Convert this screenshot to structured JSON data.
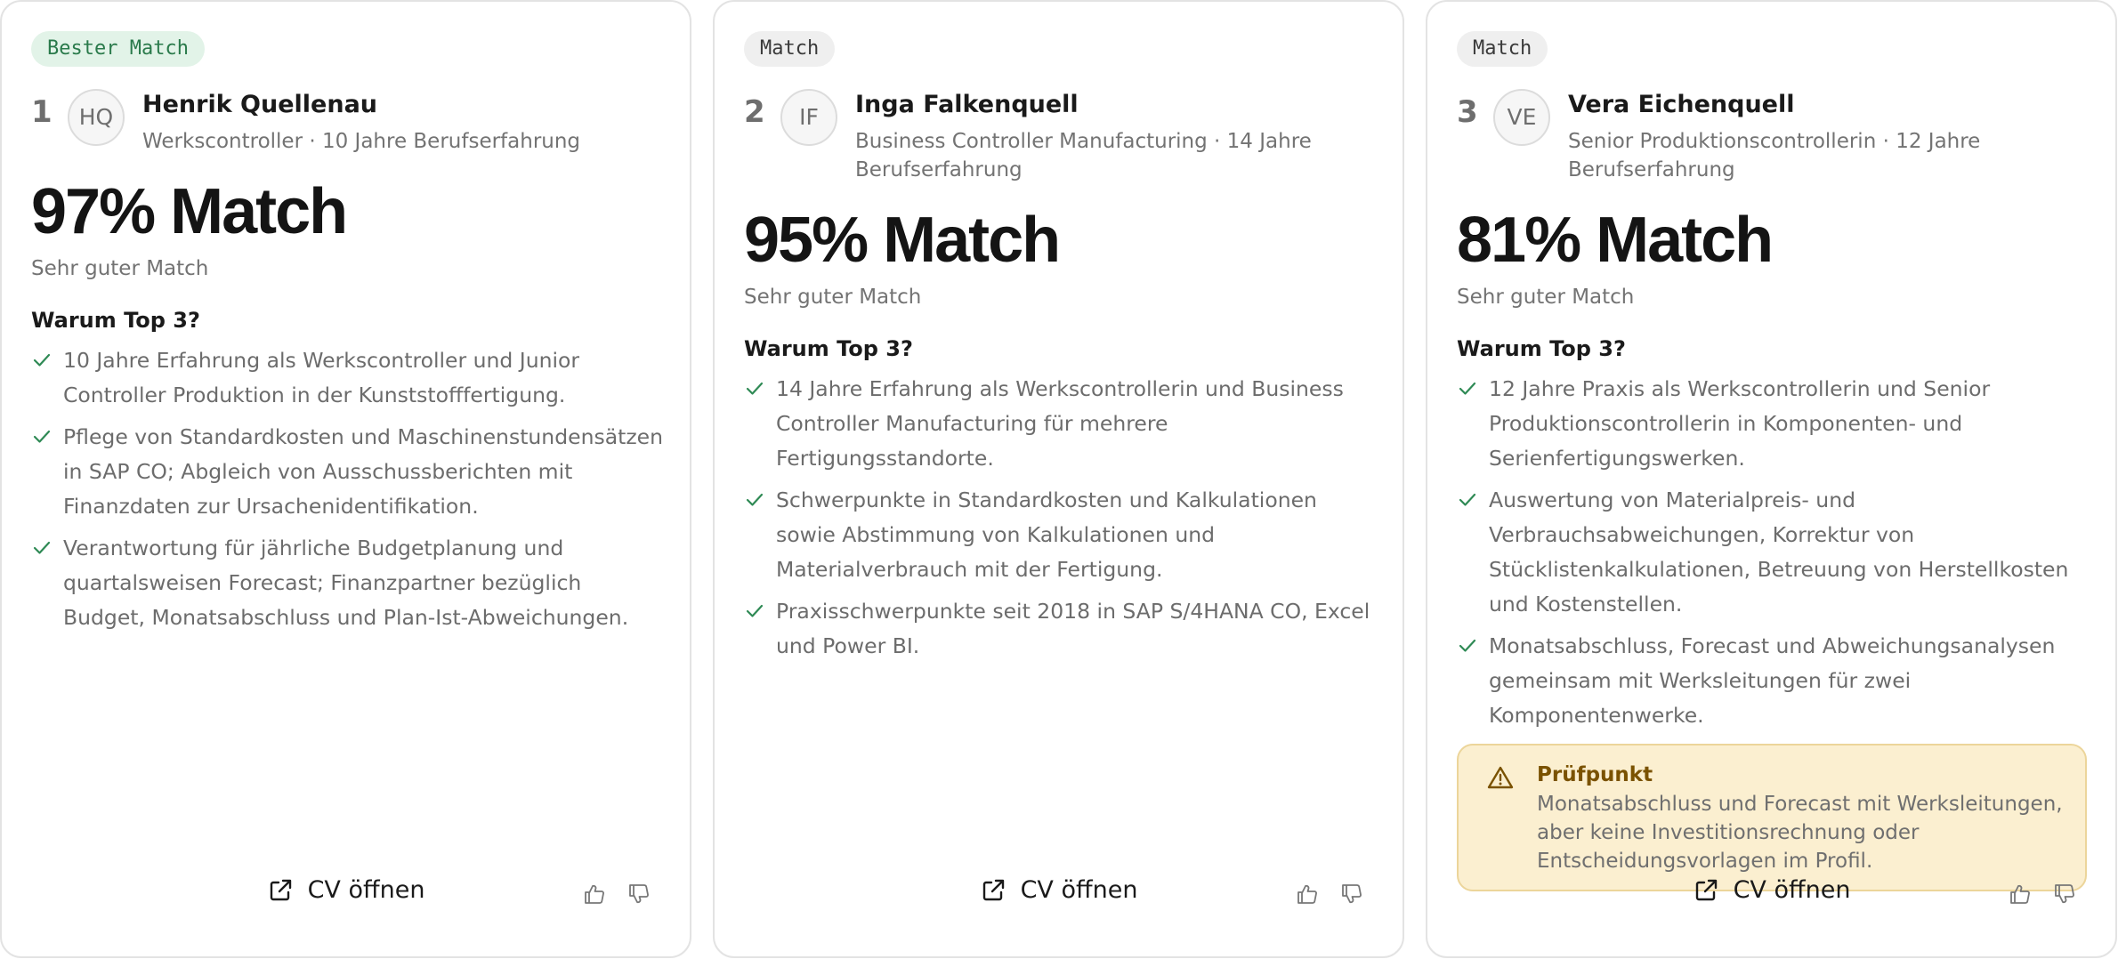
{
  "cards": [
    {
      "badge": "Bester Match",
      "rank": "1",
      "initials": "HQ",
      "name": "Henrik Quellenau",
      "meta": "Werkscontroller · 10 Jahre Berufserfahrung",
      "score": "97% Match",
      "rating": "Sehr guter Match",
      "why_title": "Warum Top 3?",
      "reasons": [
        "10 Jahre Erfahrung als Werkscontroller und Junior Controller Produktion in der Kunststofffertigung.",
        "Pflege von Standardkosten und Maschinenstundensätzen in SAP CO; Abgleich von Ausschussberichten mit Finanzdaten zur Ursachenidentifikation.",
        "Verantwortung für jährliche Budgetplanung und quartalsweisen Forecast; Finanzpartner bezüglich Budget, Monatsabschluss und Plan-Ist-Abweichungen."
      ],
      "cv_label": "CV öffnen"
    },
    {
      "badge": "Match",
      "rank": "2",
      "initials": "IF",
      "name": "Inga Falkenquell",
      "meta": "Business Controller Manufacturing · 14 Jahre Berufserfahrung",
      "score": "95% Match",
      "rating": "Sehr guter Match",
      "why_title": "Warum Top 3?",
      "reasons": [
        "14 Jahre Erfahrung als Werkscontrollerin und Business Controller Manufacturing für mehrere Fertigungsstandorte.",
        "Schwerpunkte in Standardkosten und Kalkulationen sowie Abstimmung von Kalkulationen und Materialverbrauch mit der Fertigung.",
        "Praxisschwerpunkte seit 2018 in SAP S/4HANA CO, Excel und Power BI."
      ],
      "cv_label": "CV öffnen"
    },
    {
      "badge": "Match",
      "rank": "3",
      "initials": "VE",
      "name": "Vera Eichenquell",
      "meta": "Senior Produktionscontrollerin · 12 Jahre Berufserfahrung",
      "score": "81% Match",
      "rating": "Sehr guter Match",
      "why_title": "Warum Top 3?",
      "reasons": [
        "12 Jahre Praxis als Werkscontrollerin und Senior Produktionscontrollerin in Komponenten- und Serienfertigungswerken.",
        "Auswertung von Materialpreis- und Verbrauchsabweichungen, Korrektur von Stücklistenkalkulationen, Betreuung von Herstellkosten und Kostenstellen.",
        "Monatsabschluss, Forecast und Abweichungsanalysen gemeinsam mit Werksleitungen für zwei Komponentenwerke."
      ],
      "alert": {
        "title": "Prüfpunkt",
        "text": "Monatsabschluss und Forecast mit Werksleitungen, aber keine Investitionsrechnung oder Entscheidungsvorlagen im Profil."
      },
      "cv_label": "CV öffnen"
    }
  ],
  "colors": {
    "best_badge_bg": "#e2f3e8",
    "best_badge_text": "#2a7a4b",
    "check": "#2f8a55",
    "alert_bg": "#fbefd0",
    "alert_title": "#7a5200"
  },
  "icons": {
    "check": "check-icon",
    "warning": "warning-icon",
    "external_link": "external-link-icon",
    "thumbs_up": "thumbs-up-icon",
    "thumbs_down": "thumbs-down-icon"
  }
}
